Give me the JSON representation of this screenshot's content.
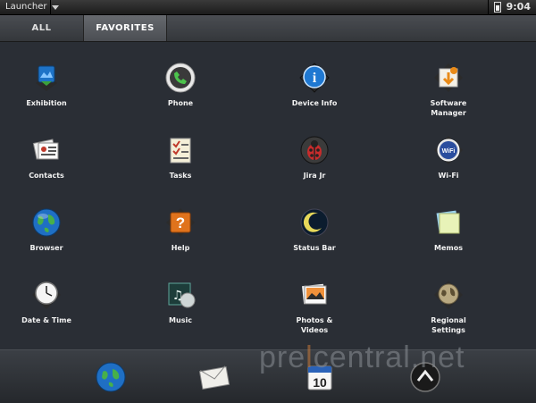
{
  "status_bar": {
    "app_name": "Launcher",
    "time": "9:04"
  },
  "tabs": [
    {
      "label": "ALL"
    },
    {
      "label": "FAVORITES"
    }
  ],
  "apps": [
    {
      "label_1": "Exhibition",
      "label_2": "",
      "icon": "exhibition-icon"
    },
    {
      "label_1": "Phone",
      "label_2": "",
      "icon": "phone-icon"
    },
    {
      "label_1": "Device Info",
      "label_2": "",
      "icon": "info-icon"
    },
    {
      "label_1": "Software",
      "label_2": "Manager",
      "icon": "software-manager-icon"
    },
    {
      "label_1": "Contacts",
      "label_2": "",
      "icon": "contacts-icon"
    },
    {
      "label_1": "Tasks",
      "label_2": "",
      "icon": "tasks-icon"
    },
    {
      "label_1": "Jira Jr",
      "label_2": "",
      "icon": "bug-icon"
    },
    {
      "label_1": "Wi-Fi",
      "label_2": "",
      "icon": "wifi-icon"
    },
    {
      "label_1": "Browser",
      "label_2": "",
      "icon": "globe-icon"
    },
    {
      "label_1": "Help",
      "label_2": "",
      "icon": "help-icon"
    },
    {
      "label_1": "Status Bar",
      "label_2": "",
      "icon": "moon-icon"
    },
    {
      "label_1": "Memos",
      "label_2": "",
      "icon": "memos-icon"
    },
    {
      "label_1": "Date & Time",
      "label_2": "",
      "icon": "clock-icon"
    },
    {
      "label_1": "Music",
      "label_2": "",
      "icon": "music-icon"
    },
    {
      "label_1": "Photos &",
      "label_2": "Videos",
      "icon": "photos-icon"
    },
    {
      "label_1": "Regional",
      "label_2": "Settings",
      "icon": "regional-settings-icon"
    }
  ],
  "dock": [
    {
      "icon": "browser-globe-icon"
    },
    {
      "icon": "email-icon"
    },
    {
      "icon": "calendar-icon",
      "text": "10"
    },
    {
      "icon": "launcher-up-icon"
    }
  ],
  "watermark": {
    "part1": "pre",
    "part2": "l",
    "part3": "central.net"
  }
}
